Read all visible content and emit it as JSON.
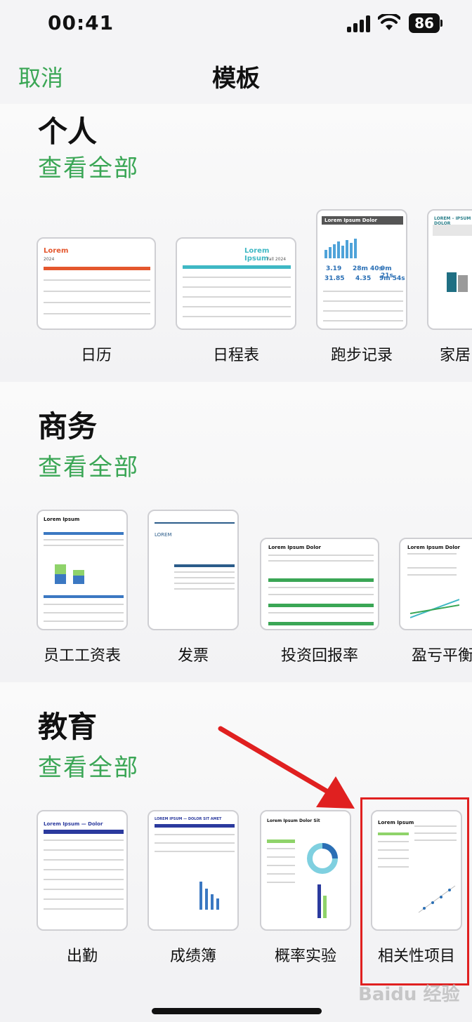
{
  "status_bar": {
    "time": "00:41",
    "battery": "86"
  },
  "nav": {
    "cancel": "取消",
    "title": "模板"
  },
  "sections": [
    {
      "title": "个人",
      "see_all": "查看全部",
      "templates": [
        {
          "label": "日历",
          "preview_title": "Lorem",
          "preview_sub": "2024"
        },
        {
          "label": "日程表",
          "preview_title": "Lorem Ipsum",
          "preview_sub": "Fall 2024"
        },
        {
          "label": "跑步记录",
          "preview_title": "Lorem Ipsum Dolor",
          "stats": [
            "3.19",
            "28m 40s",
            "9m 21s",
            "31.85",
            "4.35",
            "9m 54s"
          ]
        },
        {
          "label": "家居",
          "preview_title": "LOREM – IPSUM DOLOR"
        }
      ]
    },
    {
      "title": "商务",
      "see_all": "查看全部",
      "templates": [
        {
          "label": "员工工资表",
          "preview_title": "Lorem Ipsum"
        },
        {
          "label": "发票",
          "preview_title": "LOREM"
        },
        {
          "label": "投资回报率",
          "preview_title": "Lorem Ipsum Dolor"
        },
        {
          "label": "盈亏平衡",
          "preview_title": "Lorem Ipsum Dolor"
        }
      ]
    },
    {
      "title": "教育",
      "see_all": "查看全部",
      "templates": [
        {
          "label": "出勤",
          "preview_title": "Lorem Ipsum — Dolor"
        },
        {
          "label": "成绩簿",
          "preview_title": "LOREM IPSUM — DOLOR SIT AMET"
        },
        {
          "label": "概率实验",
          "preview_title": "Lorem Ipsum Dolor Sit"
        },
        {
          "label": "相关性项目",
          "preview_title": "Lorem Ipsum"
        }
      ]
    }
  ],
  "colors": {
    "accent": "#3aa655",
    "highlight": "#e02020"
  },
  "watermark": "Baidu 经验"
}
